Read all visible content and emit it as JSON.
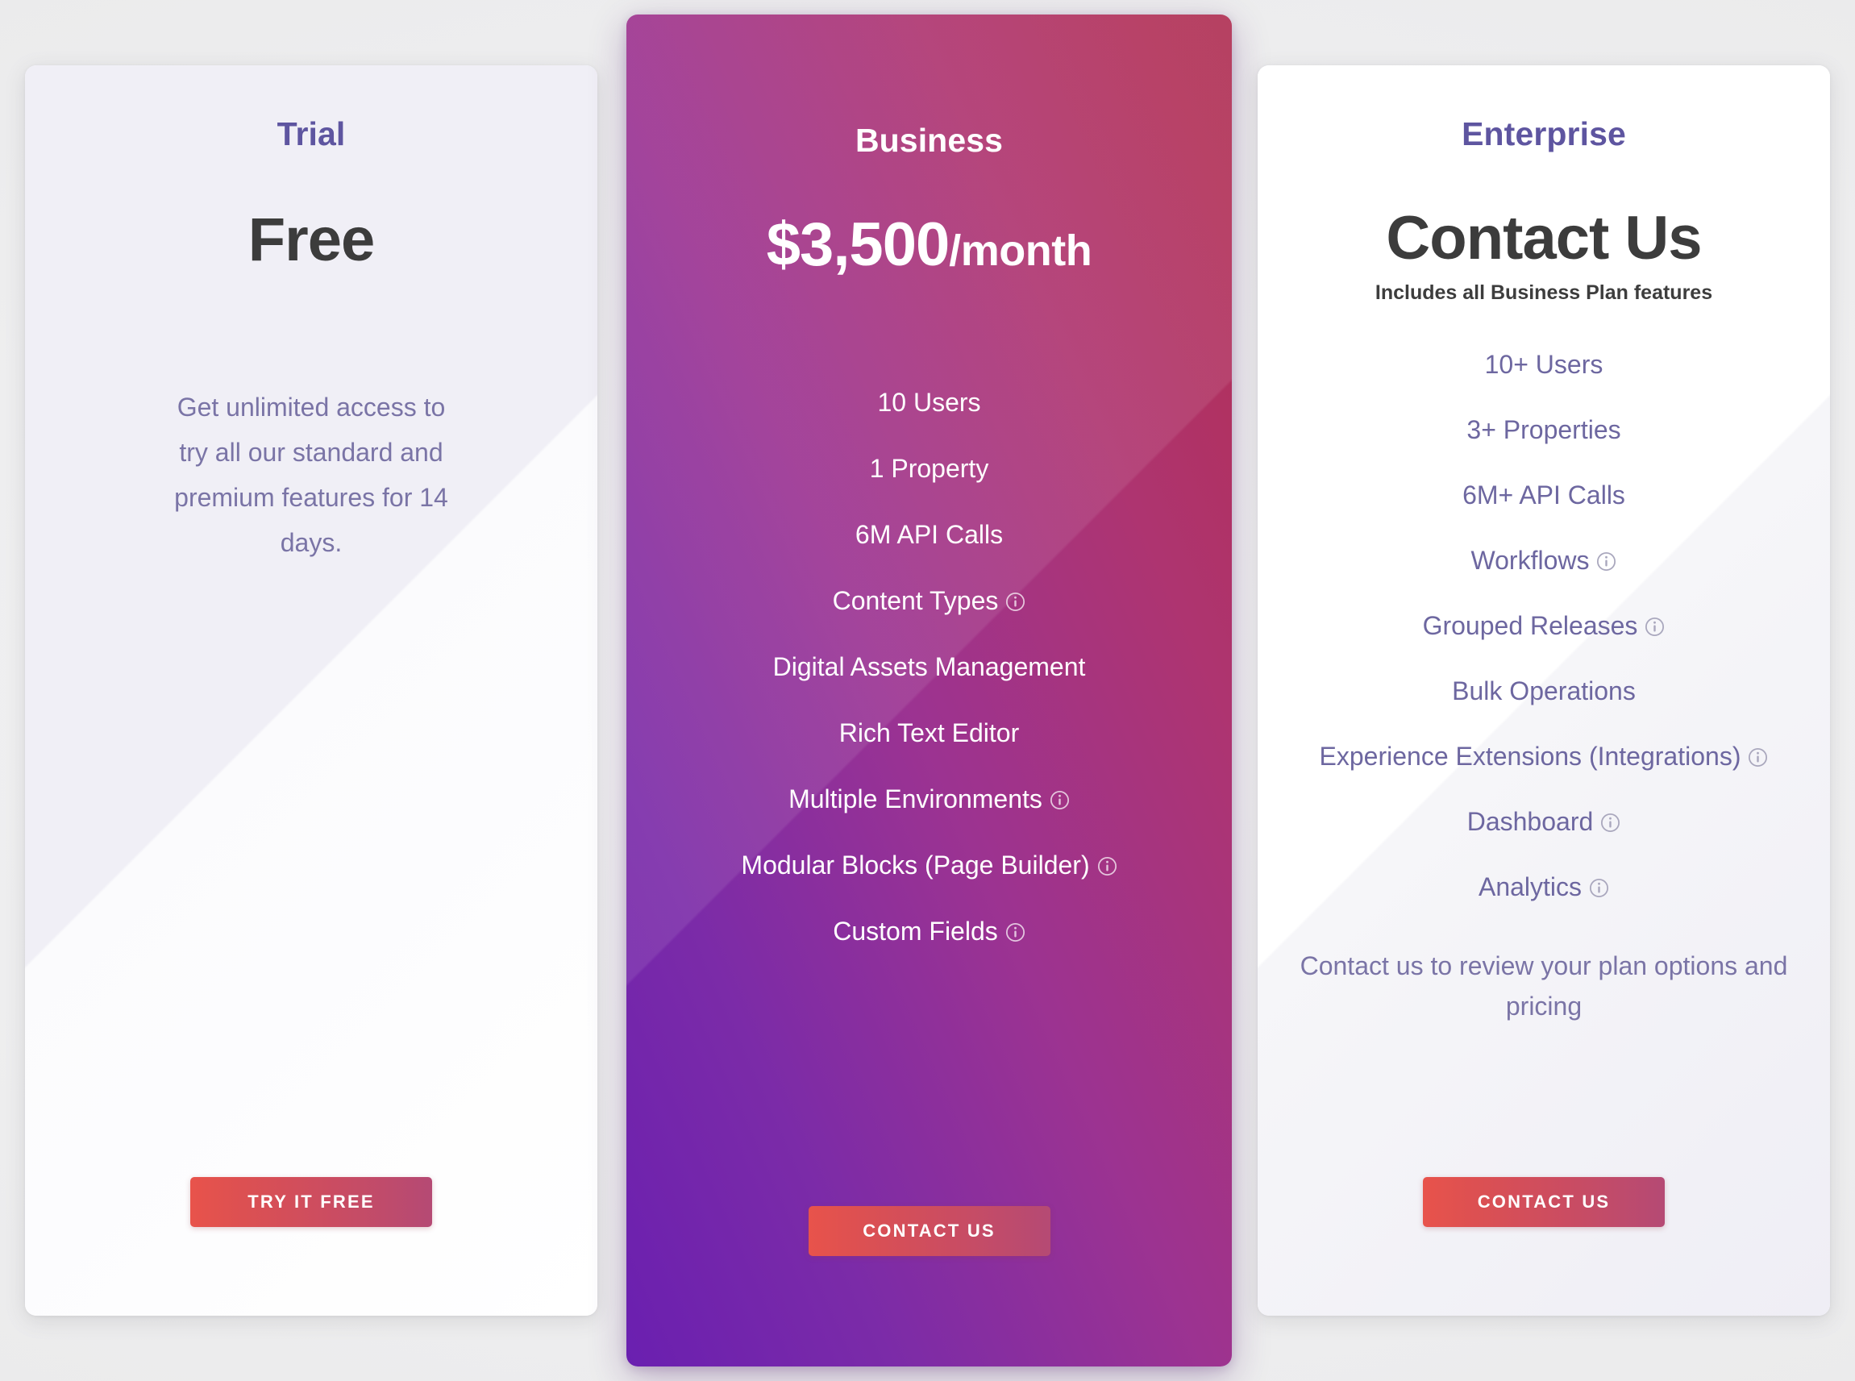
{
  "theme": {
    "page_bg": "#eeeeef",
    "accent_purple": "#5e55a0",
    "feature_purple": "#6d67a0",
    "desc_purple": "#7a74a6",
    "price_dark": "#3c3c3c",
    "cta_gradient_start": "#e8534b",
    "cta_gradient_end": "#b54a74",
    "business_gradient_start": "#6a1fb0",
    "business_gradient_end": "#af2f52"
  },
  "plans": {
    "trial": {
      "name": "Trial",
      "price": "Free",
      "description": "Get unlimited access to try all our standard and premium features for 14 days.",
      "cta_label": "TRY IT FREE"
    },
    "business": {
      "name": "Business",
      "price_amount": "$3,500",
      "price_unit": "/month",
      "cta_label": "CONTACT US",
      "features": [
        {
          "label": "10 Users",
          "info": false
        },
        {
          "label": "1 Property",
          "info": false
        },
        {
          "label": "6M API Calls",
          "info": false
        },
        {
          "label": "Content Types",
          "info": true
        },
        {
          "label": "Digital Assets Management",
          "info": false
        },
        {
          "label": "Rich Text Editor",
          "info": false
        },
        {
          "label": "Multiple Environments",
          "info": true
        },
        {
          "label": "Modular Blocks (Page Builder)",
          "info": true
        },
        {
          "label": "Custom Fields",
          "info": true
        }
      ]
    },
    "enterprise": {
      "name": "Enterprise",
      "price": "Contact Us",
      "price_note": "Includes all Business Plan features",
      "footer_note": "Contact us to review your plan options and pricing",
      "cta_label": "CONTACT US",
      "features": [
        {
          "label": "10+ Users",
          "info": false
        },
        {
          "label": "3+ Properties",
          "info": false
        },
        {
          "label": "6M+ API Calls",
          "info": false
        },
        {
          "label": "Workflows",
          "info": true
        },
        {
          "label": "Grouped Releases",
          "info": true
        },
        {
          "label": "Bulk Operations",
          "info": false
        },
        {
          "label": "Experience Extensions (Integrations)",
          "info": true
        },
        {
          "label": "Dashboard",
          "info": true
        },
        {
          "label": "Analytics",
          "info": true
        }
      ]
    }
  },
  "icons": {
    "info": "info-icon"
  }
}
